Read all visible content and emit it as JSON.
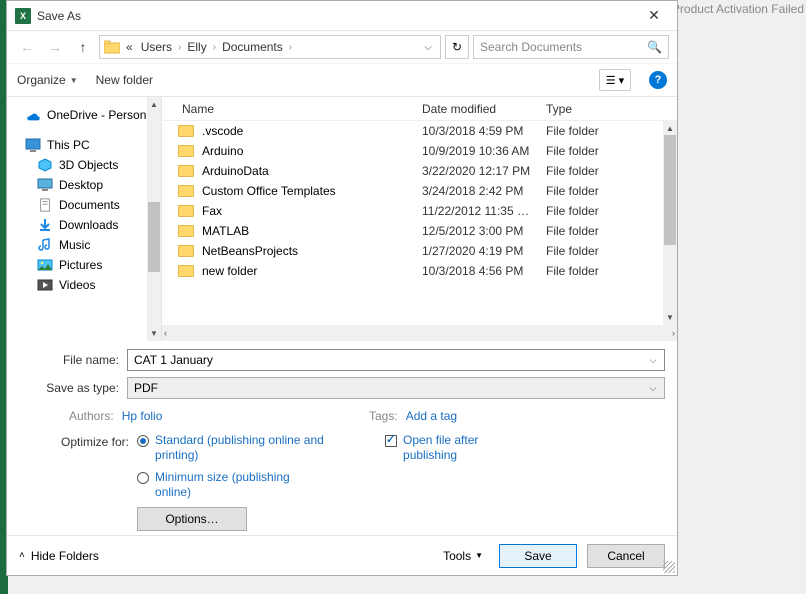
{
  "window": {
    "title": "Save As",
    "activation_text": "Product Activation Failed"
  },
  "breadcrumbs": {
    "prefix": "«",
    "items": [
      "Users",
      "Elly",
      "Documents"
    ]
  },
  "search": {
    "placeholder": "Search Documents"
  },
  "toolbar": {
    "organize": "Organize",
    "new_folder": "New folder"
  },
  "navpane": {
    "onedrive": "OneDrive - Person",
    "this_pc": "This PC",
    "children": [
      "3D Objects",
      "Desktop",
      "Documents",
      "Downloads",
      "Music",
      "Pictures",
      "Videos"
    ]
  },
  "columns": {
    "name": "Name",
    "date": "Date modified",
    "type": "Type"
  },
  "files": [
    {
      "name": ".vscode",
      "date": "10/3/2018 4:59 PM",
      "type": "File folder"
    },
    {
      "name": "Arduino",
      "date": "10/9/2019 10:36 AM",
      "type": "File folder"
    },
    {
      "name": "ArduinoData",
      "date": "3/22/2020 12:17 PM",
      "type": "File folder"
    },
    {
      "name": "Custom Office Templates",
      "date": "3/24/2018 2:42 PM",
      "type": "File folder"
    },
    {
      "name": "Fax",
      "date": "11/22/2012 11:35 …",
      "type": "File folder"
    },
    {
      "name": "MATLAB",
      "date": "12/5/2012 3:00 PM",
      "type": "File folder"
    },
    {
      "name": "NetBeansProjects",
      "date": "1/27/2020 4:19 PM",
      "type": "File folder"
    },
    {
      "name": "new folder",
      "date": "10/3/2018 4:56 PM",
      "type": "File folder"
    }
  ],
  "form": {
    "file_name_label": "File name:",
    "file_name_value": "CAT 1 January",
    "save_type_label": "Save as type:",
    "save_type_value": "PDF",
    "authors_label": "Authors:",
    "authors_value": "Hp folio",
    "tags_label": "Tags:",
    "tags_value": "Add a tag",
    "optimize_label": "Optimize for:",
    "opt_standard": "Standard (publishing online and printing)",
    "opt_minimum": "Minimum size (publishing online)",
    "open_after": "Open file after publishing",
    "options_btn": "Options…"
  },
  "footer": {
    "hide_folders": "Hide Folders",
    "tools": "Tools",
    "save": "Save",
    "cancel": "Cancel"
  }
}
